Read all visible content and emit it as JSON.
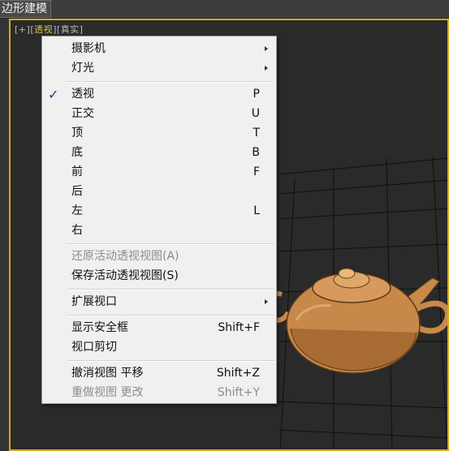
{
  "window": {
    "title": "边形建模"
  },
  "viewport": {
    "label_plus": "[+]",
    "label_view": "透视",
    "label_shading": "真实",
    "accent_color": "#d8aa18"
  },
  "menu": {
    "camera": {
      "label": "摄影机"
    },
    "lights": {
      "label": "灯光"
    },
    "perspective": {
      "label": "透视",
      "shortcut": "P",
      "checked": true
    },
    "orthographic": {
      "label": "正交",
      "shortcut": "U"
    },
    "top": {
      "label": "顶",
      "shortcut": "T"
    },
    "bottom": {
      "label": "底",
      "shortcut": "B"
    },
    "front": {
      "label": "前",
      "shortcut": "F"
    },
    "back": {
      "label": "后"
    },
    "left": {
      "label": "左",
      "shortcut": "L"
    },
    "right": {
      "label": "右"
    },
    "restore_view": {
      "label": "还原活动透视视图(A)",
      "disabled": true
    },
    "save_view": {
      "label": "保存活动透视视图(S)"
    },
    "extended_viewports": {
      "label": "扩展视口"
    },
    "safe_frame": {
      "label": "显示安全框",
      "shortcut": "Shift+F"
    },
    "viewport_clipping": {
      "label": "视口剪切"
    },
    "undo_view": {
      "label": "撤消视图 平移",
      "shortcut": "Shift+Z"
    },
    "redo_view": {
      "label": "重做视图 更改",
      "shortcut": "Shift+Y",
      "disabled": true
    }
  }
}
